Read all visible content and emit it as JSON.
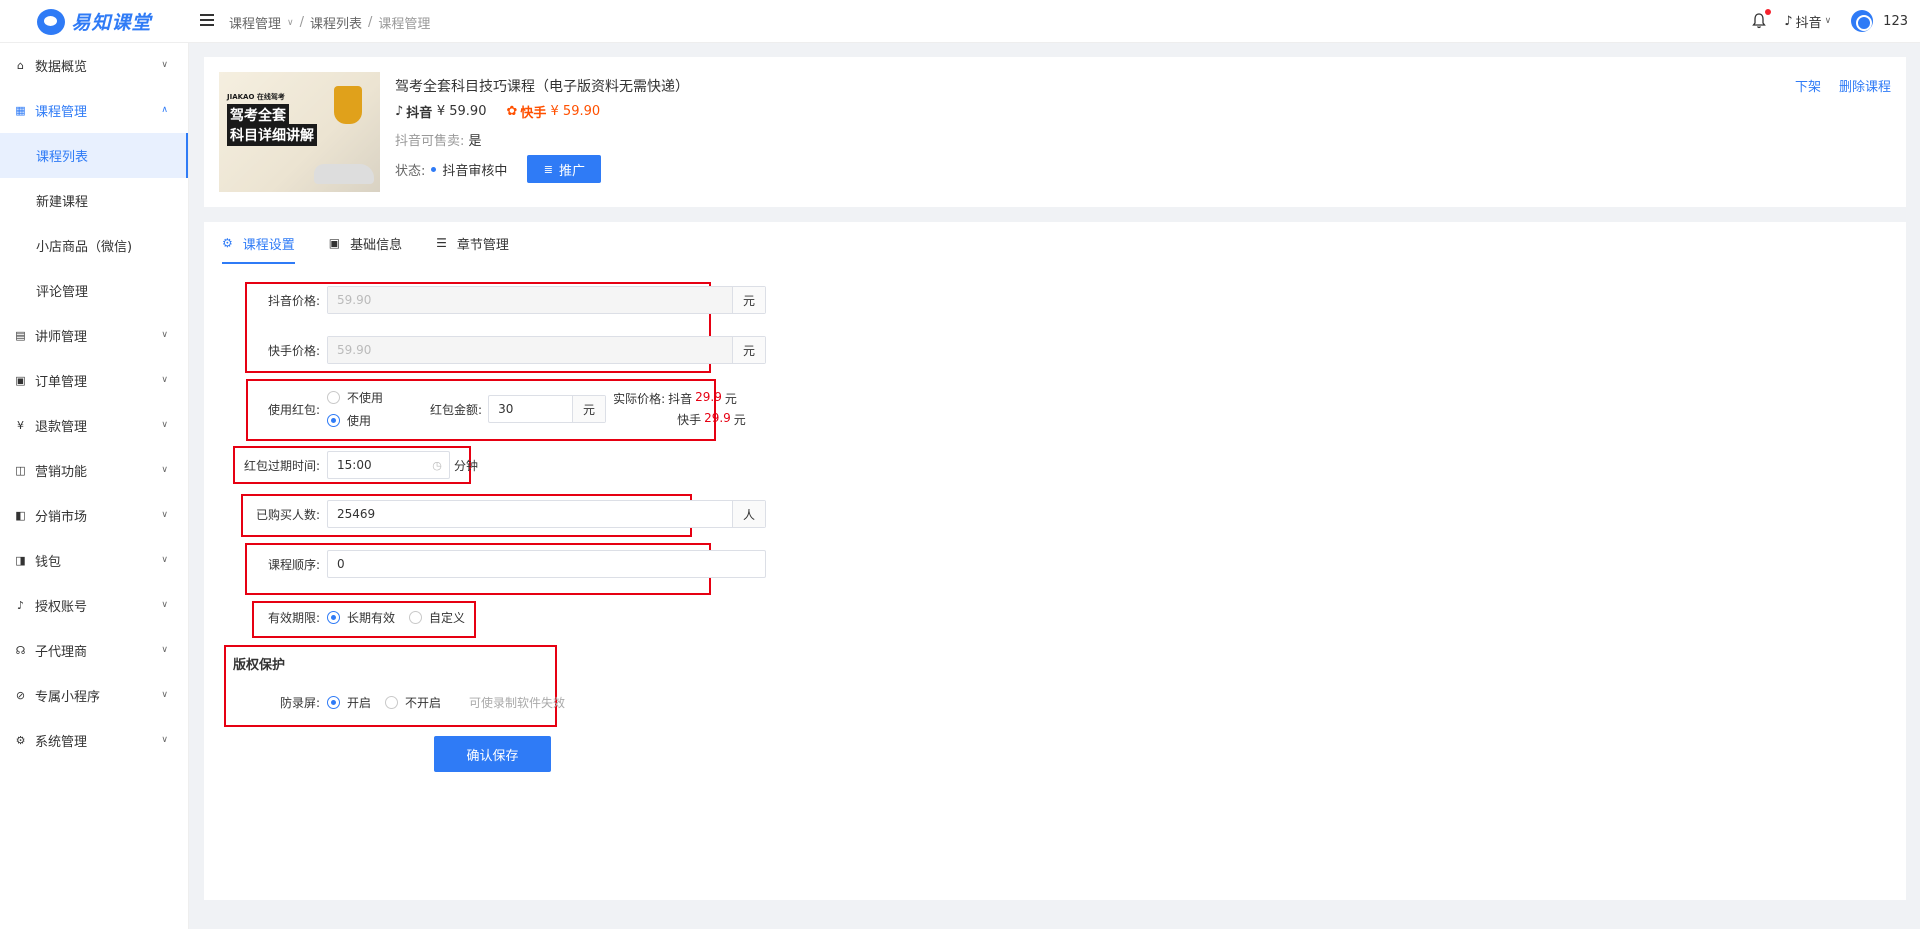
{
  "app": {
    "logo_text": "易知课堂"
  },
  "breadcrumb": [
    "课程管理",
    "课程列表",
    "课程管理"
  ],
  "topbar": {
    "platform": "抖音",
    "user": "123"
  },
  "sidebar": {
    "items": [
      {
        "label": "数据概览",
        "icon": "home-icon"
      },
      {
        "label": "课程管理",
        "icon": "grid-icon",
        "open": true,
        "children": [
          "课程列表",
          "新建课程",
          "小店商品（微信)",
          "评论管理"
        ]
      },
      {
        "label": "讲师管理",
        "icon": "teacher-icon"
      },
      {
        "label": "订单管理",
        "icon": "order-icon"
      },
      {
        "label": "退款管理",
        "icon": "refund-icon"
      },
      {
        "label": "营销功能",
        "icon": "marketing-icon"
      },
      {
        "label": "分销市场",
        "icon": "market-icon"
      },
      {
        "label": "钱包",
        "icon": "wallet-icon"
      },
      {
        "label": "授权账号",
        "icon": "tiktok-icon"
      },
      {
        "label": "子代理商",
        "icon": "agent-icon"
      },
      {
        "label": "专属小程序",
        "icon": "miniapp-icon"
      },
      {
        "label": "系统管理",
        "icon": "gear-icon"
      }
    ]
  },
  "course": {
    "title": "驾考全套科目技巧课程（电子版资料无需快递）",
    "cover_texts": {
      "brand": "JIAKAO 在线驾考",
      "line1": "驾考全套",
      "line2": "科目详细讲解"
    },
    "douyin_label": "抖音",
    "douyin_price": "¥ 59.90",
    "kuaishou_label": "快手",
    "kuaishou_price": "¥ 59.90",
    "sale_label": "抖音可售卖:",
    "sale_value": "是",
    "status_label": "状态:",
    "status_value": "抖音审核中",
    "promo_button": "推广",
    "actions": [
      "下架",
      "删除课程"
    ]
  },
  "tabs": [
    "课程设置",
    "基础信息",
    "章节管理"
  ],
  "form": {
    "douyin_price_label": "抖音价格:",
    "douyin_price_value": "59.90",
    "kuaishou_price_label": "快手价格:",
    "kuaishou_price_value": "59.90",
    "yuan": "元",
    "redpacket_label": "使用红包:",
    "redpacket_options": [
      "不使用",
      "使用"
    ],
    "redpacket_selected": "使用",
    "redpacket_amount_label": "红包金额:",
    "redpacket_amount_value": "30",
    "actual_price_label": "实际价格:",
    "actual_douyin_label": "抖音",
    "actual_douyin_value": "29.9",
    "actual_kuaishou_label": "快手",
    "actual_kuaishou_value": "29.9",
    "expire_label": "红包过期时间:",
    "expire_value": "15:00",
    "expire_unit": "分钟",
    "buyers_label": "已购买人数:",
    "buyers_value": "25469",
    "buyers_unit": "人",
    "order_label": "课程顺序:",
    "order_value": "0",
    "validity_label": "有效期限:",
    "validity_options": [
      "长期有效",
      "自定义"
    ],
    "validity_selected": "长期有效",
    "copyright_title": "版权保护",
    "anti_record_label": "防录屏:",
    "anti_record_options": [
      "开启",
      "不开启"
    ],
    "anti_record_selected": "开启",
    "anti_record_hint": "可使录制软件失效",
    "save_button": "确认保存"
  },
  "colors": {
    "accent": "#2f7bf6",
    "highlight_box": "#e60012",
    "kuaishou": "#ff5000"
  }
}
